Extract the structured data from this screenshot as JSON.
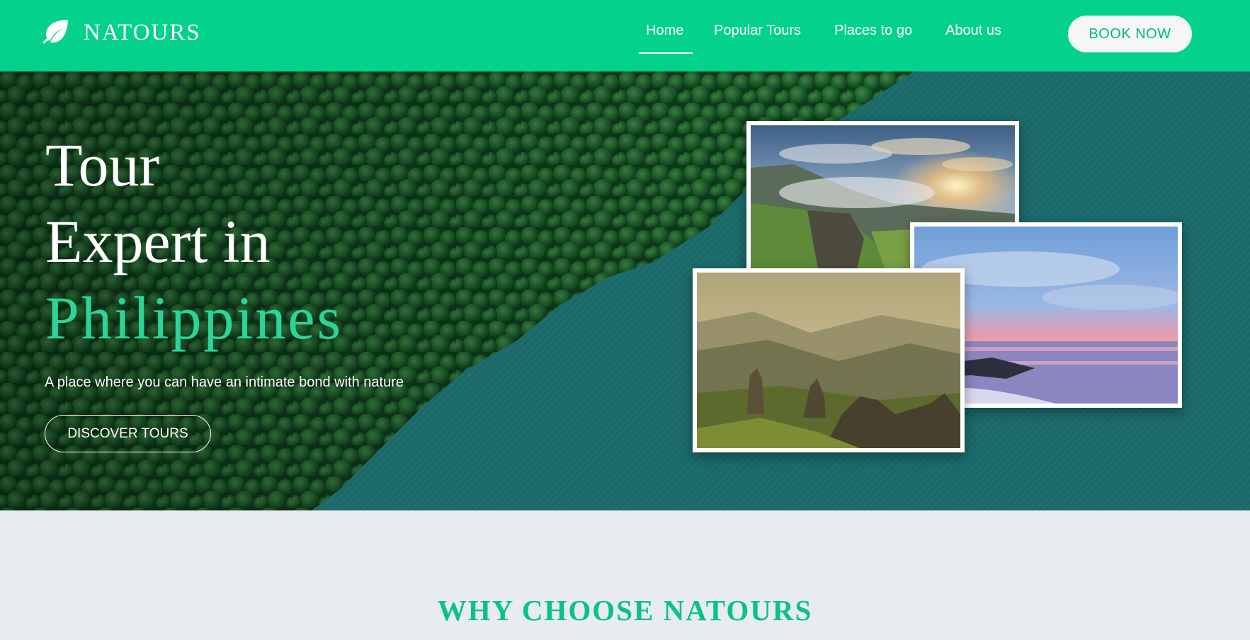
{
  "brand": {
    "name": "NATOURS",
    "icon": "leaf-icon"
  },
  "nav": {
    "links": [
      {
        "label": "Home",
        "active": true
      },
      {
        "label": "Popular Tours",
        "active": false
      },
      {
        "label": "Places to go",
        "active": false
      },
      {
        "label": "About us",
        "active": false
      }
    ],
    "book_label": "BOOK NOW"
  },
  "hero": {
    "title_line1": "Tour",
    "title_line2": "Expert in",
    "title_accent": "Philippines",
    "subtitle": "A place where you can have an intimate bond with nature",
    "cta_label": "DISCOVER TOURS"
  },
  "section": {
    "title": "WHY CHOOSE NATOURS"
  },
  "colors": {
    "brand_green": "#04d18a",
    "accent_green": "#2ed497",
    "section_title": "#08c384",
    "section_bg": "#e8ecef",
    "water": "#1b6a6a"
  }
}
